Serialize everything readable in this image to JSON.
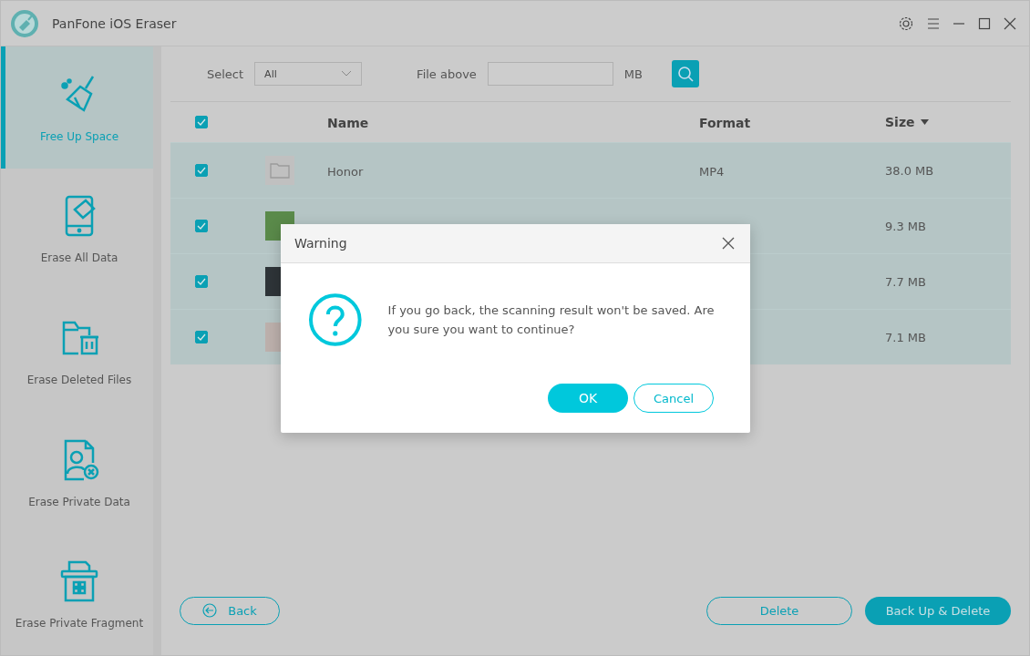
{
  "window": {
    "title": "PanFone iOS Eraser"
  },
  "sidebar": {
    "items": [
      {
        "label": "Free Up Space",
        "kind": "broom",
        "selected": true
      },
      {
        "label": "Erase All Data",
        "kind": "phone",
        "selected": false
      },
      {
        "label": "Erase Deleted Files",
        "kind": "folder",
        "selected": false
      },
      {
        "label": "Erase Private Data",
        "kind": "person",
        "selected": false
      },
      {
        "label": "Erase Private Fragment",
        "kind": "fragment",
        "selected": false
      }
    ]
  },
  "toolbar": {
    "select_label": "Select",
    "select_value": "All",
    "file_above_label": "File above",
    "unit": "MB"
  },
  "table": {
    "all_checked": true,
    "columns": [
      "Name",
      "Format",
      "Size"
    ],
    "rows": [
      {
        "checked": true,
        "kind": "folder",
        "name": "Honor",
        "format": "MP4",
        "size": "38.0 MB"
      },
      {
        "checked": true,
        "kind": "photo",
        "size": "9.3 MB"
      },
      {
        "checked": true,
        "kind": "photo",
        "size": "7.7 MB"
      },
      {
        "checked": true,
        "kind": "photo",
        "size": "7.1 MB"
      }
    ]
  },
  "footer": {
    "back": "Back",
    "delete": "Delete",
    "backup_delete": "Back Up & Delete"
  },
  "dialog": {
    "title": "Warning",
    "message": "If you go back, the scanning result won't be saved. Are you sure you want to continue?",
    "ok": "OK",
    "cancel": "Cancel"
  }
}
